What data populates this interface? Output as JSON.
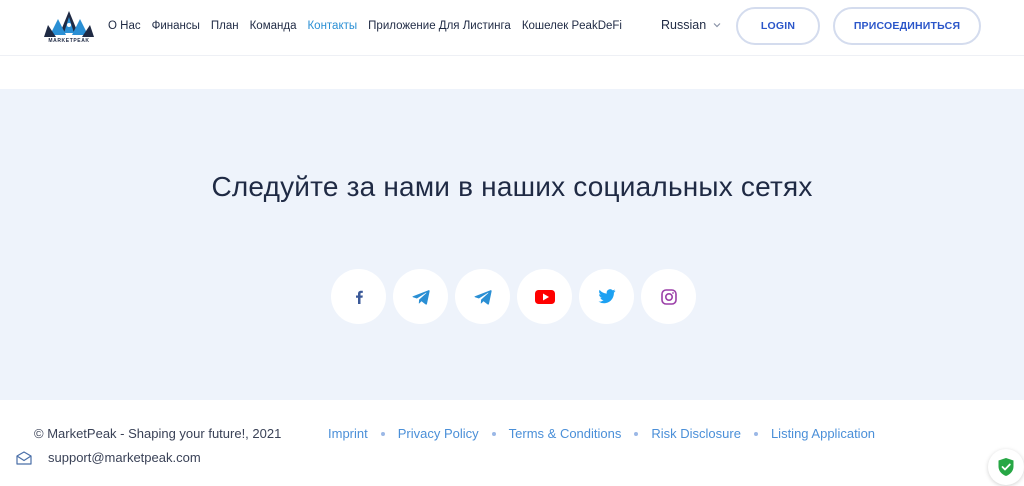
{
  "header": {
    "logo_text": "MARKETPEAK",
    "nav": [
      {
        "label": "О Нас",
        "active": false
      },
      {
        "label": "Финансы",
        "active": false
      },
      {
        "label": "План",
        "active": false
      },
      {
        "label": "Команда",
        "active": false
      },
      {
        "label": "Контакты",
        "active": true
      },
      {
        "label": "Приложение Для Листинга",
        "active": false
      },
      {
        "label": "Кошелек PeakDeFi",
        "active": false
      }
    ],
    "language": "Russian",
    "login_label": "LOGIN",
    "join_label": "ПРИСОЕДИНИТЬСЯ"
  },
  "hero": {
    "title": "Следуйте за нами в наших социальных сетях",
    "socials": [
      {
        "icon": "facebook-icon",
        "color": "#3b5998"
      },
      {
        "icon": "telegram-icon",
        "color": "#2a8fd4"
      },
      {
        "icon": "telegram-icon",
        "color": "#2a8fd4"
      },
      {
        "icon": "youtube-icon",
        "color": "#ff0000"
      },
      {
        "icon": "twitter-icon",
        "color": "#1da1f2"
      },
      {
        "icon": "instagram-icon",
        "color": "#9b3fa8"
      }
    ]
  },
  "footer": {
    "copyright": "© MarketPeak - Shaping your future!, 2021",
    "links": [
      "Imprint",
      "Privacy Policy",
      "Terms & Conditions",
      "Risk Disclosure",
      "Listing Application"
    ],
    "support_email": "support@marketpeak.com"
  },
  "colors": {
    "accent": "#2b56c9",
    "link": "#4a8fd8",
    "hero_bg": "#eef3fb",
    "text": "#1f2a44"
  }
}
